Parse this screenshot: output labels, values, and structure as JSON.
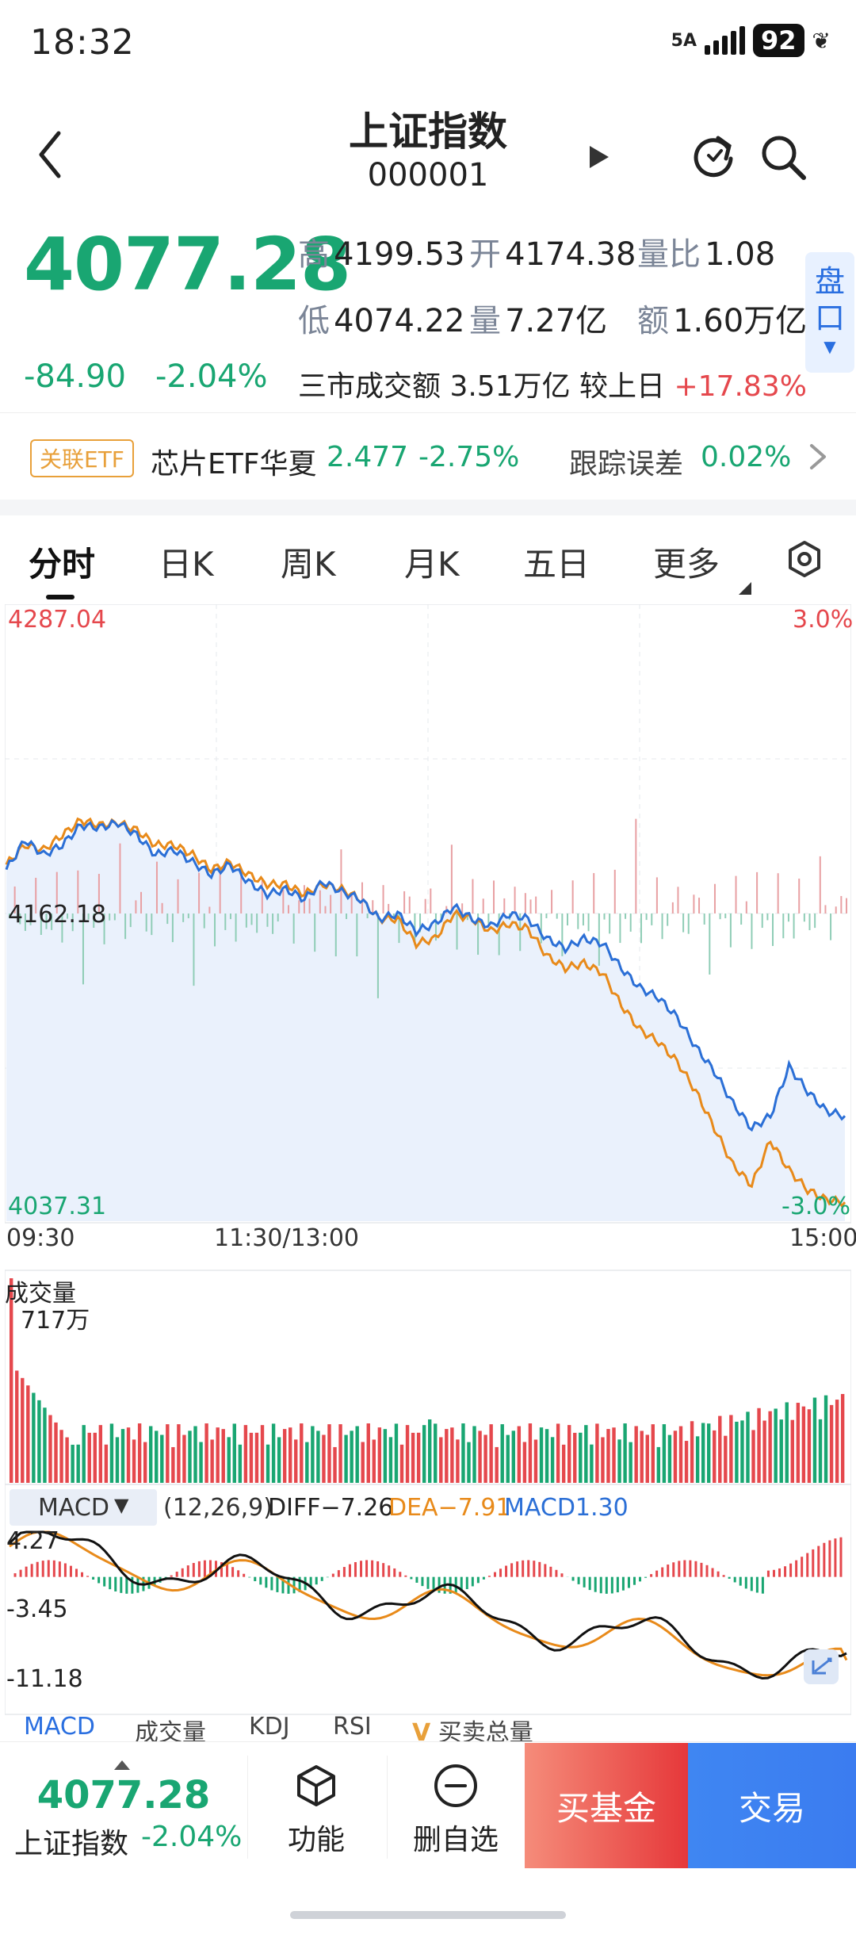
{
  "status_bar": {
    "time": "18:32",
    "network": "5A",
    "battery": "92"
  },
  "header": {
    "title": "上证指数",
    "code": "000001"
  },
  "quote": {
    "price": "4077.28",
    "change_abs": "-84.90",
    "change_pct": "-2.04%",
    "high_label": "高",
    "high": "4199.53",
    "open_label": "开",
    "open": "4174.38",
    "volume_ratio_label": "量比",
    "volume_ratio": "1.08",
    "low_label": "低",
    "low": "4074.22",
    "volume_label": "量",
    "volume": "7.27亿",
    "amount_label": "额",
    "amount": "1.60万亿",
    "turnover_text": "三市成交额 3.51万亿  较上日",
    "turnover_change": "+17.83%",
    "pankou_label": "盘口"
  },
  "etf": {
    "tag": "关联ETF",
    "name": "芯片ETF华夏",
    "price": "2.477",
    "pct": "-2.75%",
    "tracking_label": "跟踪误差",
    "tracking_value": "0.02%"
  },
  "tabs": [
    "分时",
    "日K",
    "周K",
    "月K",
    "五日",
    "更多"
  ],
  "chart_labels": {
    "price_top": "4287.04",
    "price_mid": "4162.18",
    "price_bottom": "4037.31",
    "pct_top": "3.0%",
    "pct_bottom": "-3.0%",
    "time_start": "09:30",
    "time_mid": "11:30/13:00",
    "time_end": "15:00",
    "volume_title": "成交量",
    "volume_max": "717万",
    "macd_selector": "MACD",
    "macd_params": "(12,26,9)",
    "diff": "DIFF−7.26",
    "dea": "DEA−7.91",
    "macd": "MACD1.30",
    "macd_top": "4.27",
    "macd_mid": "-3.45",
    "macd_bottom": "-11.18"
  },
  "indicator_tabs": [
    "MACD",
    "成交量",
    "KDJ",
    "RSI",
    "买卖总量"
  ],
  "bottom_bar": {
    "price": "4077.28",
    "name": "上证指数",
    "pct": "-2.04%",
    "function_label": "功能",
    "remove_label": "删自选",
    "buy_fund_label": "买基金",
    "trade_label": "交易"
  },
  "colors": {
    "up": "#e5484d",
    "down": "#19a672",
    "price_line": "#2b6fd6",
    "avg_line": "#e88a1a",
    "accent": "#2a6fe0"
  },
  "chart_data": {
    "type": "line",
    "title": "",
    "x_range": [
      "09:30",
      "15:00"
    ],
    "ylim": [
      4037.31,
      4287.04
    ],
    "pct_range": [
      -3.0,
      3.0
    ],
    "prev_close": 4162.18,
    "series": [
      {
        "name": "price",
        "values": [
          4180,
          4192,
          4186,
          4190,
          4198,
          4197,
          4199,
          4194,
          4186,
          4188,
          4183,
          4178,
          4182,
          4175,
          4170,
          4172,
          4168,
          4175,
          4171,
          4168,
          4160,
          4162,
          4155,
          4158,
          4165,
          4160,
          4157,
          4162,
          4160,
          4152,
          4148,
          4152,
          4150,
          4140,
          4132,
          4128,
          4120,
          4108,
          4098,
          4085,
          4075,
          4080,
          4100,
          4090,
          4082,
          4080
        ]
      },
      {
        "name": "avg",
        "values": [
          4182,
          4190,
          4188,
          4194,
          4200,
          4198,
          4199,
          4196,
          4190,
          4190,
          4186,
          4180,
          4183,
          4178,
          4174,
          4174,
          4170,
          4174,
          4172,
          4168,
          4160,
          4160,
          4150,
          4152,
          4162,
          4160,
          4155,
          4158,
          4156,
          4145,
          4140,
          4142,
          4138,
          4125,
          4115,
          4110,
          4102,
          4090,
          4075,
          4060,
          4052,
          4070,
          4058,
          4050,
          4046,
          4045
        ]
      }
    ],
    "volume_max": "717万",
    "macd": {
      "params": "(12,26,9)",
      "diff": -7.26,
      "dea": -7.91,
      "macd": 1.3,
      "ylim": [
        -11.18,
        4.27
      ]
    }
  }
}
